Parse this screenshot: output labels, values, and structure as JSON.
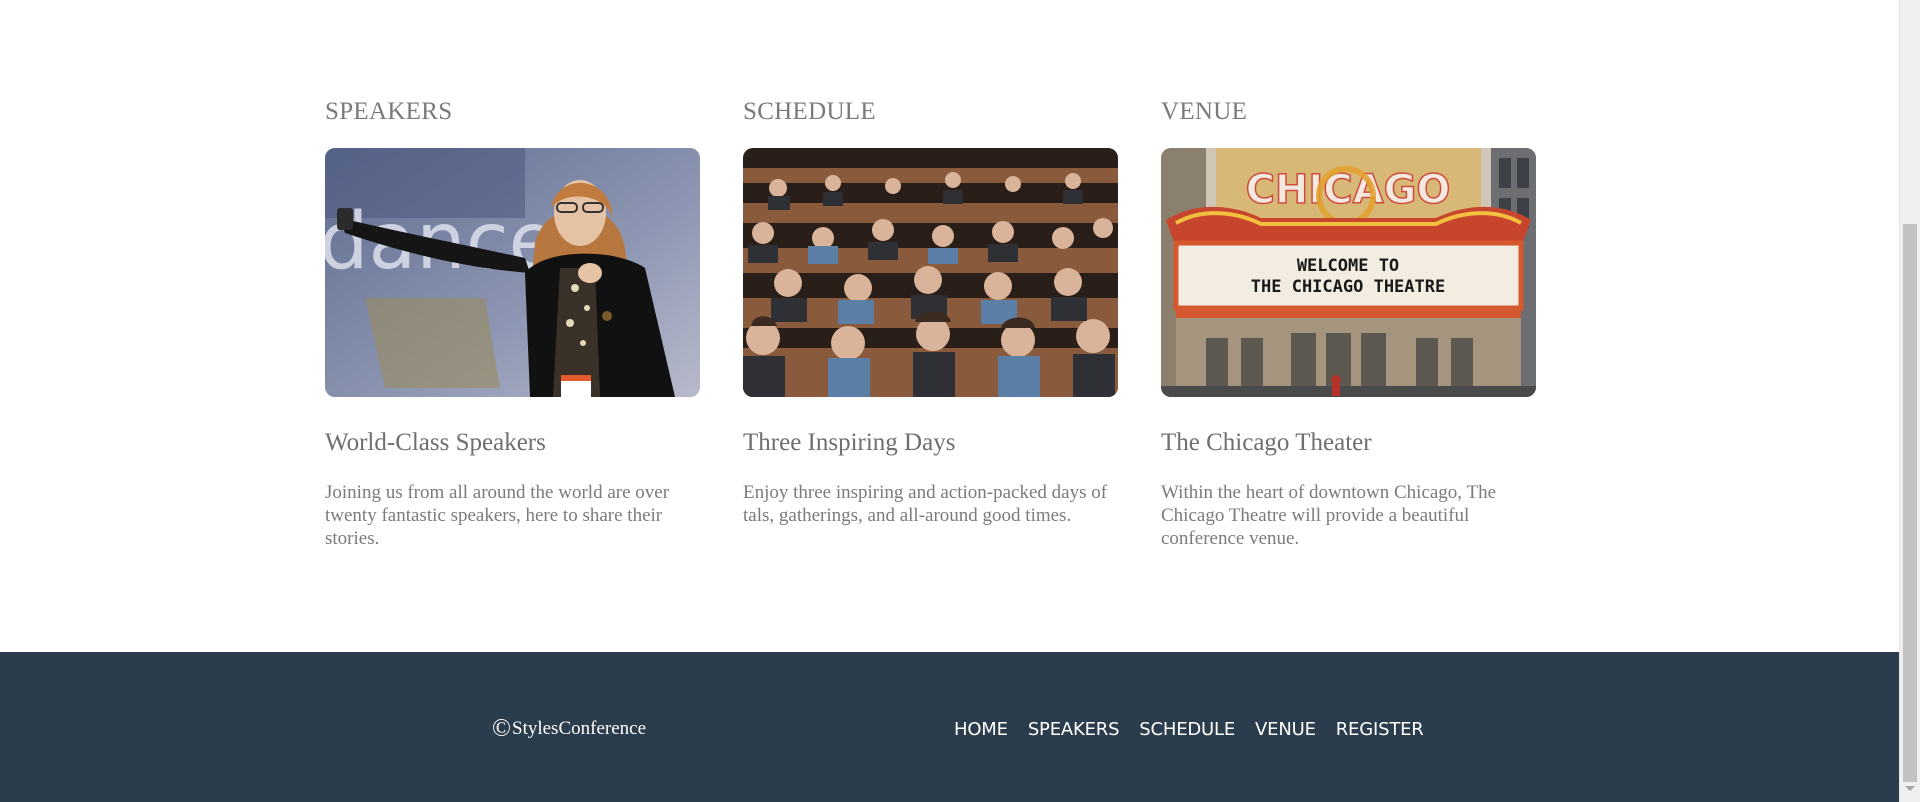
{
  "sections": [
    {
      "title": "SPEAKERS",
      "heading": "World-Class Speakers",
      "text": "Joining us from all around the world are over twenty fantastic speakers, here to share their stories.",
      "image": "speaker-photo",
      "image_backdrop_text": "dance"
    },
    {
      "title": "SCHEDULE",
      "heading": "Three Inspiring Days",
      "text": "Enjoy three inspiring and action-packed days of tals, gatherings, and all-around good times.",
      "image": "audience-photo"
    },
    {
      "title": "VENUE",
      "heading": "The Chicago Theater",
      "text": "Within the heart of downtown Chicago, The Chicago Theatre will provide a beautiful conference venue.",
      "image": "chicago-theatre-photo",
      "marquee_sign": "CHICAGO",
      "marquee_line1": "WELCOME TO",
      "marquee_line2": "THE CHICAGO THEATRE"
    }
  ],
  "footer": {
    "copyright_symbol": "©",
    "brand": "StylesConference",
    "nav": [
      "HOME",
      "SPEAKERS",
      "SCHEDULE",
      "VENUE",
      "REGISTER"
    ],
    "background": "#2b3d4c"
  },
  "colors": {
    "text_gray": "#7a7a7a",
    "footer_bg": "#2b3d4c",
    "footer_text": "#ffffff"
  }
}
